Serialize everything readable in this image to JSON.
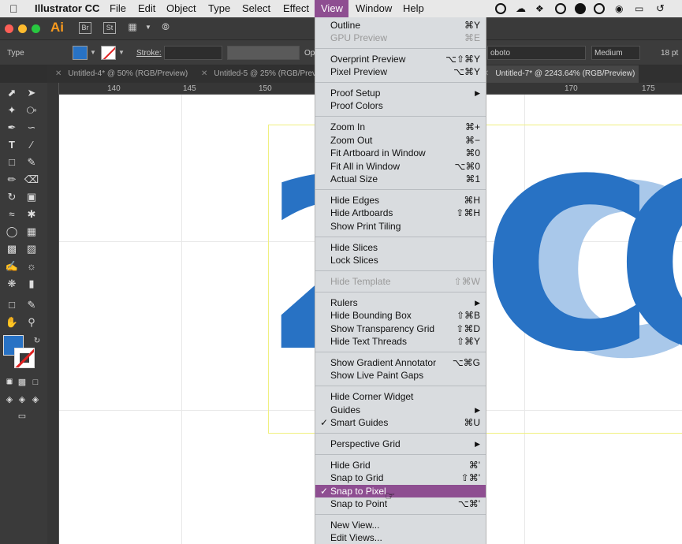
{
  "menubar": {
    "app_name": "Illustrator CC",
    "menus": [
      "File",
      "Edit",
      "Object",
      "Type",
      "Select",
      "Effect",
      "View",
      "Window",
      "Help"
    ],
    "apple_icon": "apple-icon"
  },
  "appbar": {
    "logo": "Ai",
    "bridge": "Br",
    "stock": "St"
  },
  "controlbar": {
    "type_label": "Type",
    "stroke_label": "Stroke:",
    "opacity_label": "Op",
    "font": "oboto",
    "weight": "Medium",
    "size": "18 pt"
  },
  "tabs": [
    {
      "label": "Untitled-4* @ 50% (RGB/Preview)"
    },
    {
      "label": "Untitled-5 @ 25% (RGB/Preview)"
    },
    {
      "label": "Untitled-7* @ 2243.64% (RGB/Preview)"
    }
  ],
  "ruler": {
    "ticks": [
      "140",
      "145",
      "150",
      "170",
      "175"
    ]
  },
  "canvas": {
    "text_front": "2",
    "text_back": "CC",
    "text_mid": "C"
  },
  "view_menu": {
    "items": [
      {
        "label": "Outline",
        "shortcut": "⌘Y"
      },
      {
        "label": "GPU Preview",
        "shortcut": "⌘E"
      },
      {
        "label": "Overprint Preview",
        "shortcut": "⌥⇧⌘Y"
      },
      {
        "label": "Pixel Preview",
        "shortcut": "⌥⌘Y"
      },
      {
        "label": "Proof Setup",
        "shortcut": ""
      },
      {
        "label": "Proof Colors",
        "shortcut": ""
      },
      {
        "label": "Zoom In",
        "shortcut": "⌘+"
      },
      {
        "label": "Zoom Out",
        "shortcut": "⌘−"
      },
      {
        "label": "Fit Artboard in Window",
        "shortcut": "⌘0"
      },
      {
        "label": "Fit All in Window",
        "shortcut": "⌥⌘0"
      },
      {
        "label": "Actual Size",
        "shortcut": "⌘1"
      },
      {
        "label": "Hide Edges",
        "shortcut": "⌘H"
      },
      {
        "label": "Hide Artboards",
        "shortcut": "⇧⌘H"
      },
      {
        "label": "Show Print Tiling",
        "shortcut": ""
      },
      {
        "label": "Hide Slices",
        "shortcut": ""
      },
      {
        "label": "Lock Slices",
        "shortcut": ""
      },
      {
        "label": "Hide Template",
        "shortcut": "⇧⌘W"
      },
      {
        "label": "Rulers",
        "shortcut": ""
      },
      {
        "label": "Hide Bounding Box",
        "shortcut": "⇧⌘B"
      },
      {
        "label": "Show Transparency Grid",
        "shortcut": "⇧⌘D"
      },
      {
        "label": "Hide Text Threads",
        "shortcut": "⇧⌘Y"
      },
      {
        "label": "Show Gradient Annotator",
        "shortcut": "⌥⌘G"
      },
      {
        "label": "Show Live Paint Gaps",
        "shortcut": ""
      },
      {
        "label": "Hide Corner Widget",
        "shortcut": ""
      },
      {
        "label": "Guides",
        "shortcut": ""
      },
      {
        "label": "Smart Guides",
        "shortcut": "⌘U"
      },
      {
        "label": "Perspective Grid",
        "shortcut": ""
      },
      {
        "label": "Hide Grid",
        "shortcut": "⌘'"
      },
      {
        "label": "Snap to Grid",
        "shortcut": "⇧⌘'"
      },
      {
        "label": "Snap to Pixel",
        "shortcut": ""
      },
      {
        "label": "Snap to Point",
        "shortcut": "⌥⌘'"
      },
      {
        "label": "New View...",
        "shortcut": ""
      },
      {
        "label": "Edit Views...",
        "shortcut": ""
      }
    ],
    "checkmark": "✓",
    "submenu_arrow": "▶"
  },
  "colors": {
    "accent": "#8e4e91",
    "fill": "#2872c4",
    "fill_light": "#a9c8ea"
  }
}
